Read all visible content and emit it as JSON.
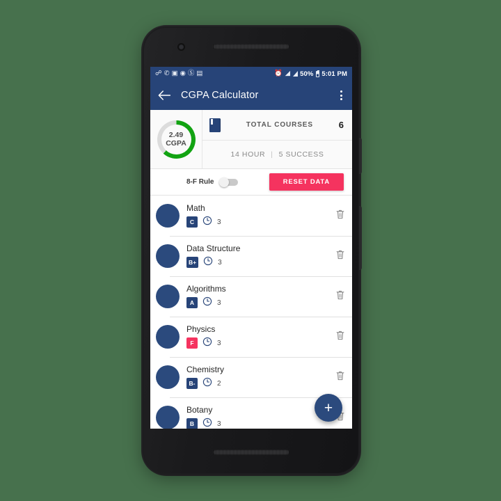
{
  "status_bar": {
    "left_icons": [
      "bluetooth-icon",
      "whatsapp-icon",
      "photos-icon",
      "apps-icon",
      "no-sound-icon",
      "video-icon"
    ],
    "alarm_icon": "alarm-icon",
    "wifi_icon": "wifi-icon",
    "signal_icon": "signal-icon",
    "battery_percent": "50%",
    "battery_icon": "battery-icon",
    "time": "5:01 PM"
  },
  "app_bar": {
    "back_icon": "back-arrow-icon",
    "title": "CGPA Calculator",
    "overflow_icon": "overflow-menu-icon"
  },
  "summary": {
    "gpa_value": "2.49",
    "gpa_label": "CGPA",
    "gpa_ring_percent": 62,
    "gpa_ring_color": "#12a312",
    "gpa_ring_track_color": "#dcdcdc",
    "book_icon": "book-icon",
    "total_courses_label": "TOTAL COURSES",
    "total_courses_value": "6",
    "hours": "14 HOUR",
    "separator": "|",
    "success": "5 SUCCESS"
  },
  "controls": {
    "rule_label": "8-F Rule",
    "rule_toggle_on": false,
    "reset_label": "RESET DATA",
    "reset_color": "#f5335f"
  },
  "courses": [
    {
      "name": "Math",
      "grade": "C",
      "fail": false,
      "credits": "3",
      "clock_icon": "clock-icon",
      "delete_icon": "trash-icon",
      "avatar": "avatar"
    },
    {
      "name": "Data Structure",
      "grade": "B+",
      "fail": false,
      "credits": "3",
      "clock_icon": "clock-icon",
      "delete_icon": "trash-icon",
      "avatar": "avatar"
    },
    {
      "name": "Algorithms",
      "grade": "A",
      "fail": false,
      "credits": "3",
      "clock_icon": "clock-icon",
      "delete_icon": "trash-icon",
      "avatar": "avatar"
    },
    {
      "name": "Physics",
      "grade": "F",
      "fail": true,
      "credits": "3",
      "clock_icon": "clock-icon",
      "delete_icon": "trash-icon",
      "avatar": "avatar"
    },
    {
      "name": "Chemistry",
      "grade": "B-",
      "fail": false,
      "credits": "2",
      "clock_icon": "clock-icon",
      "delete_icon": "trash-icon",
      "avatar": "avatar"
    },
    {
      "name": "Botany",
      "grade": "B",
      "fail": false,
      "credits": "3",
      "clock_icon": "clock-icon",
      "delete_icon": "trash-icon",
      "avatar": "avatar"
    }
  ],
  "fab": {
    "icon": "plus-icon",
    "label": "+"
  },
  "theme": {
    "primary": "#274478",
    "accent": "#f5335f",
    "background": "#47714d",
    "avatar": "#2b4a7d"
  }
}
